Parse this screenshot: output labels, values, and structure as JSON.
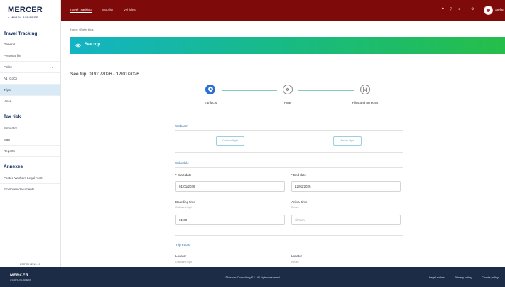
{
  "brand": {
    "name": "MERCER",
    "tagline": "A MARSH BUSINESS"
  },
  "sidebar": {
    "sections": [
      {
        "title": "Travel Tracking",
        "items": [
          {
            "label": "General"
          },
          {
            "label": "Personal file"
          },
          {
            "label": "Policy"
          },
          {
            "label": "A1 (CoC)"
          },
          {
            "label": "Trips",
            "active": true
          },
          {
            "label": "Visas"
          }
        ]
      },
      {
        "title": "Tax risk",
        "items": [
          {
            "label": "Simulator"
          },
          {
            "label": "Map"
          },
          {
            "label": "Reports"
          }
        ]
      },
      {
        "title": "Annexes",
        "items": [
          {
            "label": "Posted Workers Legal Alert"
          },
          {
            "label": "Employee documents"
          }
        ]
      }
    ],
    "version": "EMPGH 2.19.15"
  },
  "topbar": {
    "tabs": [
      {
        "label": "Travel Tracking",
        "active": true
      },
      {
        "label": "Mobility"
      },
      {
        "label": "Vehicles"
      }
    ],
    "user_name": "Stefan",
    "icons": [
      "flag-icon",
      "search-icon",
      "bell-icon",
      "gear-icon"
    ]
  },
  "breadcrumb": {
    "home": "Home",
    "current": "Enter trips"
  },
  "banner": {
    "title": "See trip",
    "color_start": "#13b4c4",
    "color_end": "#26be4a"
  },
  "page_title": "See trip: 01/01/2026 - 12/01/2026",
  "steps": [
    {
      "label": "Trip facts",
      "state": "current"
    },
    {
      "label": "PMD",
      "state": "future"
    },
    {
      "label": "Files and annexes",
      "state": "future"
    }
  ],
  "webcam": {
    "heading": "Webcam",
    "outbound_button": "Outward flight",
    "return_button": "Return flight"
  },
  "schedule": {
    "heading": "Schedule",
    "start_label": "* Start date",
    "start_value": "01/01/2026",
    "end_label": "* End date",
    "end_value": "12/01/2026",
    "boarding_label": "Boarding time",
    "boarding_sub": "Outbound flight",
    "boarding_value": "01:00",
    "arrival_label": "Arrival time",
    "arrival_sub": "Return",
    "arrival_placeholder": "hh:mm"
  },
  "trip_facts": {
    "heading": "Trip Facts",
    "locator_out_label": "Locator",
    "locator_out_sub": "Outbound flight",
    "locator_ret_label": "Locator",
    "locator_ret_sub": "Return"
  },
  "footer": {
    "brand": "MERCER",
    "tagline": "A MARSH BUSINESS",
    "copyright": "©Mercer Consulting S.L. All rights reserved",
    "links": [
      "Legal notice",
      "Privacy policy",
      "Cookie policy"
    ]
  }
}
